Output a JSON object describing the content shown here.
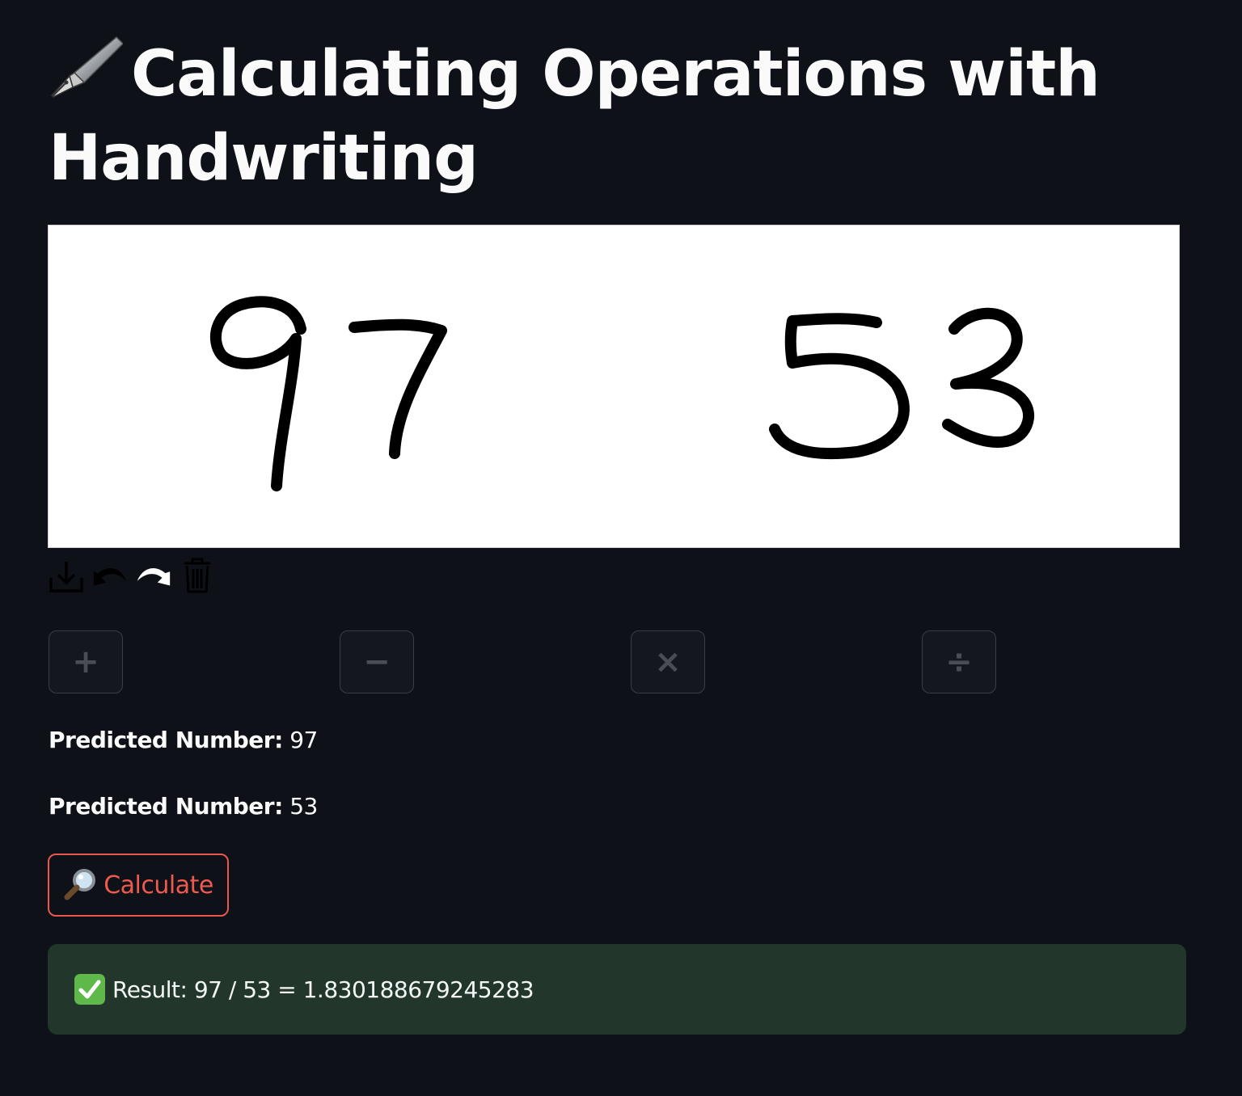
{
  "header": {
    "title_icon": "fountain-pen-icon",
    "title": "Calculating Operations with Handwriting"
  },
  "canvas": {
    "background": "#ffffff",
    "stroke_color": "#000000",
    "handwritten_left": "97",
    "handwritten_right": "53"
  },
  "toolbar": {
    "tools": [
      "download-icon",
      "undo-icon",
      "redo-icon",
      "trash-icon"
    ]
  },
  "operators": [
    {
      "symbol": "+",
      "icon": "plus-icon"
    },
    {
      "symbol": "−",
      "icon": "minus-icon"
    },
    {
      "symbol": "×",
      "icon": "multiply-icon"
    },
    {
      "symbol": "÷",
      "icon": "divide-icon"
    }
  ],
  "predictions": [
    {
      "label": "Predicted Number:",
      "value": "97"
    },
    {
      "label": "Predicted Number:",
      "value": "53"
    }
  ],
  "calculate_button": {
    "icon": "magnifier-icon",
    "label": "Calculate",
    "accent": "#ef5a4f"
  },
  "result": {
    "icon": "check-icon",
    "text": "Result: 97 / 53 = 1.830188679245283",
    "background": "#22362b"
  }
}
